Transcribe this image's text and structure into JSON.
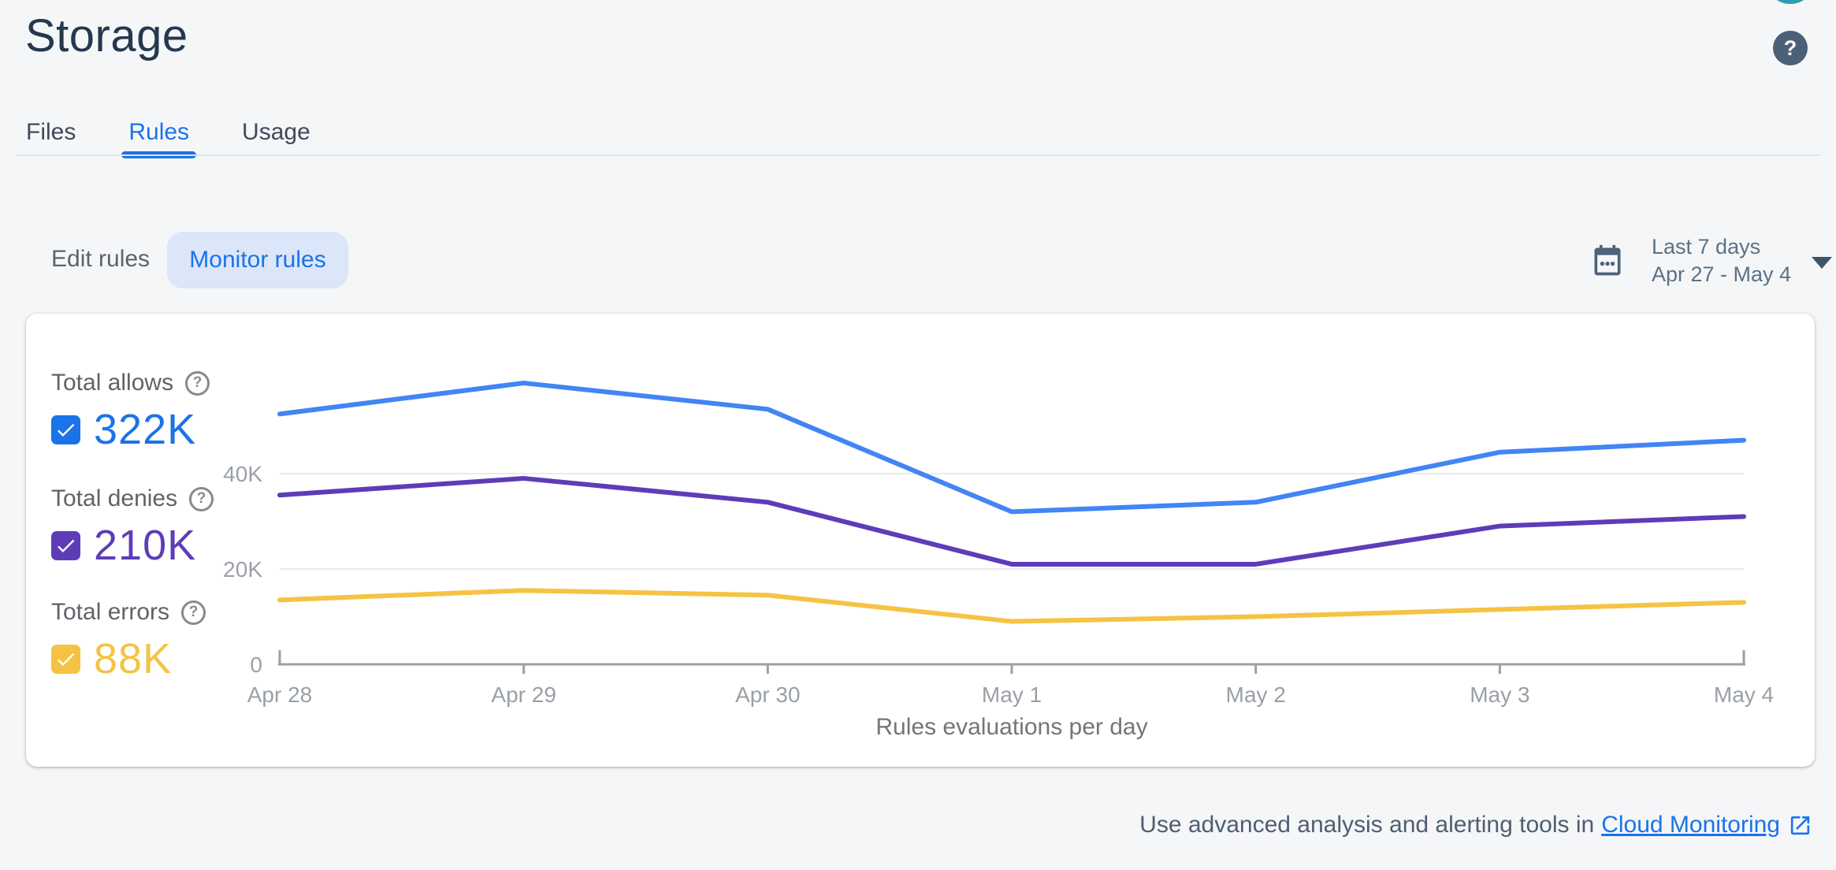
{
  "header": {
    "title": "Storage"
  },
  "icons": {
    "question_mark": "?"
  },
  "tabs": [
    {
      "label": "Files",
      "active": false
    },
    {
      "label": "Rules",
      "active": true
    },
    {
      "label": "Usage",
      "active": false
    }
  ],
  "toolbar": {
    "edit_rules_label": "Edit rules",
    "monitor_rules_label": "Monitor rules",
    "date_range": {
      "label": "Last 7 days",
      "dates": "Apr 27 - May 4"
    }
  },
  "legend": [
    {
      "label": "Total allows",
      "value": "322K",
      "color": "#1A73E8",
      "checked": true
    },
    {
      "label": "Total denies",
      "value": "210K",
      "color": "#5E3CB8",
      "checked": true
    },
    {
      "label": "Total errors",
      "value": "88K",
      "color": "#F5C344",
      "checked": true
    }
  ],
  "chart_data": {
    "type": "line",
    "title": "Rules evaluations per day",
    "x": [
      "Apr 28",
      "Apr 29",
      "Apr 30",
      "May 1",
      "May 2",
      "May 3",
      "May 4"
    ],
    "series": [
      {
        "name": "Total allows",
        "color": "#4285F4",
        "values": [
          52500,
          59000,
          53500,
          32000,
          34000,
          44500,
          47000
        ]
      },
      {
        "name": "Total denies",
        "color": "#5E3CB8",
        "values": [
          35500,
          39000,
          34000,
          21000,
          21000,
          29000,
          31000
        ]
      },
      {
        "name": "Total errors",
        "color": "#F5C344",
        "values": [
          13500,
          15500,
          14500,
          9000,
          10000,
          11500,
          13000
        ]
      }
    ],
    "yticks": [
      {
        "value": 0,
        "label": "0"
      },
      {
        "value": 20000,
        "label": "20K"
      },
      {
        "value": 40000,
        "label": "40K"
      }
    ],
    "ylim": [
      0,
      62000
    ],
    "grid": "horizontal",
    "legend_position": "left"
  },
  "footer": {
    "text": "Use advanced analysis and alerting tools in",
    "link_label": "Cloud Monitoring"
  }
}
